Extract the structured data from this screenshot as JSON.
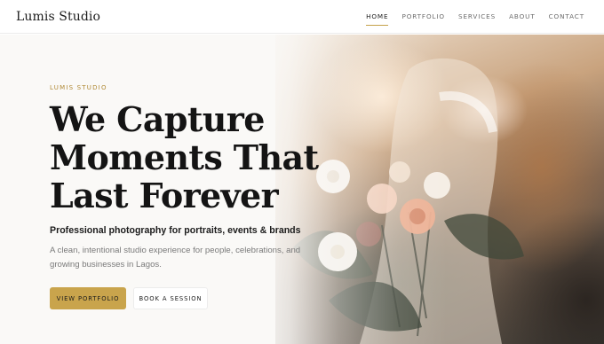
{
  "header": {
    "logo": "Lumis Studio",
    "nav": [
      {
        "label": "HOME",
        "active": true
      },
      {
        "label": "PORTFOLIO",
        "active": false
      },
      {
        "label": "SERVICES",
        "active": false
      },
      {
        "label": "ABOUT",
        "active": false
      },
      {
        "label": "CONTACT",
        "active": false
      }
    ]
  },
  "hero": {
    "eyebrow": "LUMIS STUDIO",
    "headline_lines": [
      "We Capture",
      "Moments That",
      "Last Forever"
    ],
    "subhead": "Professional photography for portraits, events & brands",
    "description": "A clean, intentional studio experience for people, celebrations, and growing businesses in Lagos.",
    "primary_cta": "VIEW PORTFOLIO",
    "secondary_cta": "BOOK A SESSION"
  },
  "colors": {
    "accent": "#c9a44c",
    "eyebrow": "#b08a36",
    "headline": "#141414",
    "body_text": "#7a7a7a"
  }
}
